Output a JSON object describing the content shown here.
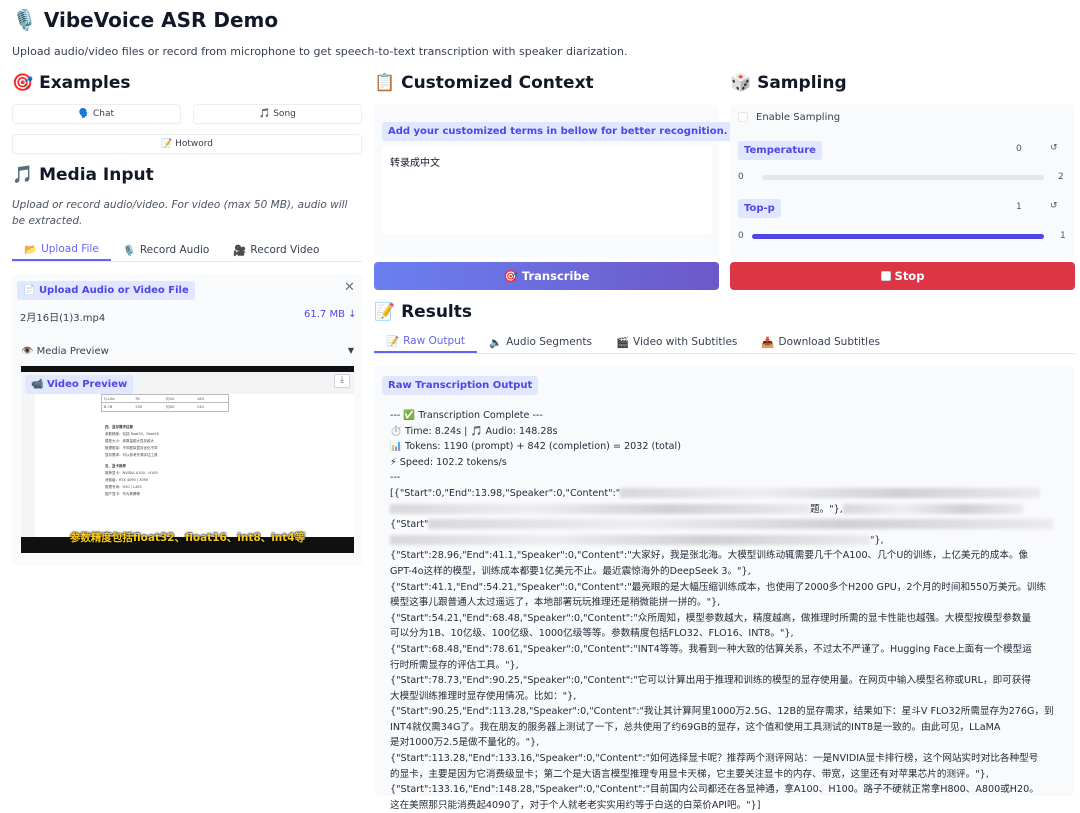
{
  "app": {
    "title": "VibeVoice ASR Demo",
    "subtitle": "Upload audio/video files or record from microphone to get speech-to-text transcription with speaker diarization."
  },
  "examples": {
    "heading": "Examples",
    "items": [
      {
        "label": "Chat",
        "icon": "speaking-head-icon"
      },
      {
        "label": "Song",
        "icon": "music-note-icon"
      },
      {
        "label": "Hotword",
        "icon": "memo-icon"
      }
    ]
  },
  "media_input": {
    "heading": "Media Input",
    "hint": "Upload or record audio/video. For video (max 50 MB), audio will be extracted.",
    "tabs": [
      {
        "label": "Upload File",
        "active": true
      },
      {
        "label": "Record Audio",
        "active": false
      },
      {
        "label": "Record Video",
        "active": false
      }
    ],
    "upload_label": "Upload Audio or Video File",
    "file_name": "2月16日(1)3.mp4",
    "file_size": "61.7 MB ↓",
    "preview_label": "Media Preview",
    "video_label": "Video Preview",
    "video_caption": "参数精度包括float32、float16、int8、int4等",
    "video_doc_cells": [
      [
        "Q-Lite",
        "7B",
        "约4G",
        "16G"
      ],
      [
        "B-7B",
        "13B",
        "约8G",
        "24G"
      ]
    ],
    "video_doc_lines": [
      "四、显存需求估算",
      "参数精度：包括 float32、float16",
      "模型大小：参数量越大显存越大",
      "推理框架：不同框架显存优化不同",
      "显存需求：可以参考开源评估工具",
      "五、显卡推荐",
      "推荐显卡：NVIDIA A100、H100",
      "消费级：RTX 4090 / 3090",
      "推理专用：H20 / L40S",
      "国产显卡：华为昇腾等"
    ]
  },
  "context": {
    "heading": "Customized Context",
    "label": "Add your customized terms in bellow for better recognition.",
    "value": "转录成中文"
  },
  "sampling": {
    "heading": "Sampling",
    "enable_label": "Enable Sampling",
    "temperature": {
      "label": "Temperature",
      "value": "0",
      "min": "0",
      "max": "2",
      "fraction": 0.0
    },
    "top_p": {
      "label": "Top-p",
      "value": "1",
      "min": "0",
      "max": "1",
      "fraction": 1.0
    }
  },
  "actions": {
    "transcribe": "Transcribe",
    "stop": "Stop"
  },
  "results": {
    "heading": "Results",
    "tabs": [
      {
        "label": "Raw Output",
        "active": true
      },
      {
        "label": "Audio Segments",
        "active": false
      },
      {
        "label": "Video with Subtitles",
        "active": false
      },
      {
        "label": "Download Subtitles",
        "active": false
      }
    ],
    "output_label": "Raw Transcription Output",
    "status_lines": [
      "--- ✅ Transcription Complete ---",
      "⏱️ Time: 8.24s | 🎵 Audio: 148.28s",
      "📊 Tokens: 1190 (prompt) + 842 (completion) = 2032 (total)",
      "⚡ Speed: 102.2 tokens/s",
      "---"
    ],
    "segment_lines": [
      "[{\"Start\":0,\"End\":13.98,\"Speaker\":0,\"Content\":\"",
      "题。\"},",
      "{\"Start\"",
      "\"},",
      "{\"Start\":28.96,\"End\":41.1,\"Speaker\":0,\"Content\":\"大家好，我是张北海。大模型训练动辄需要几千个A100、几个U的训练，上亿美元的成本。像",
      "GPT-4o这样的模型，训练成本都要1亿美元不止。最近震惊海外的DeepSeek 3。\"},",
      "{\"Start\":41.1,\"End\":54.21,\"Speaker\":0,\"Content\":\"最亮眼的是大幅压缩训练成本，也使用了2000多个H200 GPU，2个月的时间和550万美元。训练",
      "模型这事儿跟普通人太过遥远了，本地部署玩玩推理还是稍微能拼一拼的。\"},",
      "{\"Start\":54.21,\"End\":68.48,\"Speaker\":0,\"Content\":\"众所周知，模型参数越大，精度越高，做推理时所需的显卡性能也越强。大模型按模型参数量",
      "可以分为1B、10亿级、100亿级、1000亿级等等。参数精度包括FLO32、FLO16、INT8。\"},",
      "{\"Start\":68.48,\"End\":78.61,\"Speaker\":0,\"Content\":\"INT4等等。我看到一种大致的估算关系，不过太不严谨了。Hugging Face上面有一个模型运",
      "行时所需显存的评估工具。\"},",
      "{\"Start\":78.73,\"End\":90.25,\"Speaker\":0,\"Content\":\"它可以计算出用于推理和训练的模型的显存使用量。在网页中输入模型名称或URL，即可获得",
      "大模型训练推理时显存使用情况。比如：\"},",
      "{\"Start\":90.25,\"End\":113.28,\"Speaker\":0,\"Content\":\"我让其计算阿里1000万2.5G、12B的显存需求，结果如下：星斗V FLO32所需显存为276G，到",
      "INT4就仅需34G了。我在朋友的服务器上测试了一下，总共使用了约69GB的显存，这个值和使用工具测试的INT8是一致的。由此可见，LLaMA",
      "是对1000万2.5是做不量化的。\"},",
      "{\"Start\":113.28,\"End\":133.16,\"Speaker\":0,\"Content\":\"如何选择显卡呢？推荐两个测评网站：一是NVIDIA显卡排行榜，这个网站实时对比各种型号",
      "的显卡，主要是因为它消费级显卡；第二个是大语言模型推理专用显卡天梯，它主要关注显卡的内存、带宽，这里还有对苹果芯片的测评。\"},",
      "{\"Start\":133.16,\"End\":148.28,\"Speaker\":0,\"Content\":\"目前国内公司都还在各显神通，拿A100、H100。路子不硬就正常拿H800、A800或H20。",
      "这在美照那只能消费起4090了，对于个人就老老实实用约等于白送的白菜价API吧。\"}]"
    ]
  },
  "colors": {
    "accent": "#6366f1",
    "stop": "#dc3545",
    "pill_bg": "#e0e7ff"
  }
}
